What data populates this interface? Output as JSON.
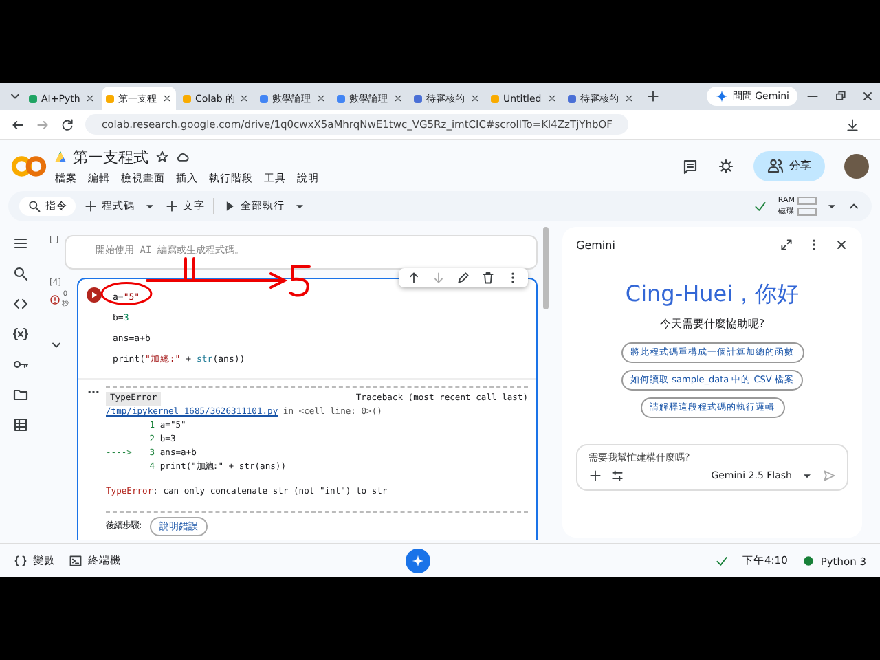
{
  "browser": {
    "tabs": [
      {
        "label": "AI+Pyth",
        "kind": "drive",
        "selected": false
      },
      {
        "label": "第一支程",
        "kind": "colab",
        "selected": true
      },
      {
        "label": "Colab 的",
        "kind": "colab",
        "selected": false
      },
      {
        "label": "數學論理",
        "kind": "doc",
        "selected": false
      },
      {
        "label": "數學論理",
        "kind": "doc",
        "selected": false
      },
      {
        "label": "待審核的",
        "kind": "people",
        "selected": false
      },
      {
        "label": "Untitled",
        "kind": "colab",
        "selected": false
      },
      {
        "label": "待審核的",
        "kind": "people",
        "selected": false
      }
    ],
    "ask_button": "問問 Gemini",
    "address": "colab.research.google.com/drive/1q0cwxX5aMhrqNwE1twc_VG5Rz_imtCIC#scrollTo=Kl4ZzTjYhbOF"
  },
  "notebook": {
    "title": "第一支程式",
    "menus": [
      "檔案",
      "編輯",
      "檢視畫面",
      "插入",
      "執行階段",
      "工具",
      "說明"
    ],
    "share": "分享",
    "toolbar": [
      "指令",
      "程式碼",
      "文字",
      "全部執行"
    ],
    "ram": "RAM",
    "disk": "磁碟"
  },
  "cells": {
    "empty_prompt": "[ ]",
    "placeholder": "開始使用 AI 編寫或生成程式碼。",
    "exec_count": "[4]",
    "exec_time": "0\n秒",
    "code": [
      [
        {
          "t": "a=",
          "kind": "plain"
        },
        {
          "t": "\"5\"",
          "kind": "str"
        }
      ],
      [
        {
          "t": "b=",
          "kind": "plain"
        },
        {
          "t": "3",
          "kind": "num"
        }
      ],
      [
        {
          "t": "ans=a+b",
          "kind": "plain"
        }
      ],
      [
        {
          "t": "print(",
          "kind": "plain"
        },
        {
          "t": "\"加總:\"",
          "kind": "str"
        },
        {
          "t": "  +  ",
          "kind": "plain"
        },
        {
          "t": "str",
          "kind": "fn"
        },
        {
          "t": "(ans))",
          "kind": "plain"
        }
      ]
    ],
    "output": {
      "error_name": "TypeError",
      "traceback": "Traceback (most recent call last)",
      "file": "/tmp/ipykernel_1685/3626311101.py",
      "location": " in <cell line: 0>()",
      "lines": [
        {
          "no": "1",
          "code": "a=\"5\""
        },
        {
          "no": "2",
          "code": "b=3"
        },
        {
          "arrow": "---->",
          "no": "3",
          "code": "ans=a+b"
        },
        {
          "no": "4",
          "code": "print(\"加總:\" + str(ans))"
        }
      ],
      "message_type": "TypeError",
      "message": ": can only concatenate str (not \"int\") to str",
      "next_label": "後續步驟:",
      "explain": "說明錯誤"
    }
  },
  "gemini": {
    "title": "Gemini",
    "greeting": "Cing-Huei，你好",
    "question": "今天需要什麼協助呢?",
    "suggestions": [
      "將此程式碼重構成一個計算加總的函數",
      "如何讀取 sample_data 中的 CSV 檔案",
      "請解釋這段程式碼的執行邏輯"
    ],
    "placeholder": "需要我幫忙建構什麼嗎?",
    "model": "Gemini 2.5 Flash"
  },
  "status_bar": {
    "variables": "變數",
    "terminal": "終端機",
    "time": "下午4:10",
    "runtime": "Python 3"
  }
}
